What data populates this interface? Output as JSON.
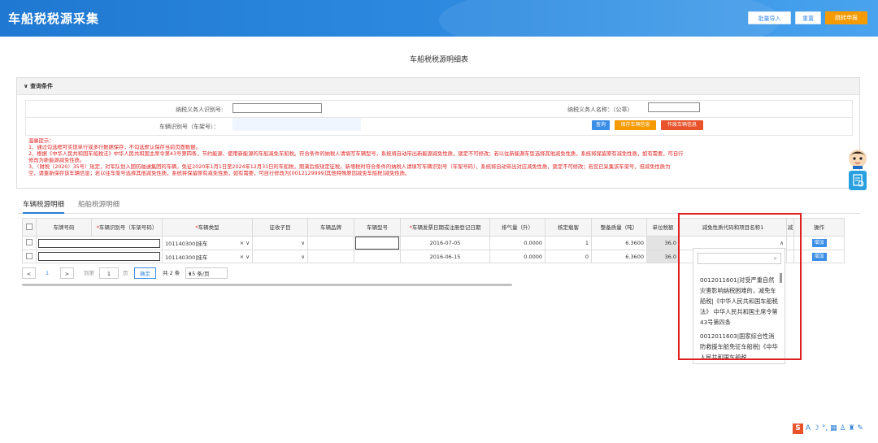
{
  "header": {
    "title": "车船税税源采集",
    "buttons": {
      "batch_import": "批量导入",
      "reset": "重置",
      "jump_declare": "跳转申报"
    }
  },
  "page_title": "车船税税源明细表",
  "query": {
    "section_title": "查询条件",
    "taxpayer_id_label": "纳税义务人识别号:",
    "taxpayer_id_value": "",
    "taxpayer_name_label": "纳税义务人名称：（公章）",
    "taxpayer_name_value": "",
    "vin_label": "车辆识别号（车架号）：",
    "vin_value": "",
    "buttons": {
      "query": "查询",
      "save_vehicle": "保存车辆信息",
      "void_vehicle": "作废车辆信息"
    }
  },
  "tips": {
    "title": "温馨提示：",
    "lines": [
      "1、通过勾选框可实现单行或多行数据保存，不勾选默认保存当前页面数据。",
      "2、根据《中华人民共和国车船税法》中华人民共和国主席令第43号第四条，节约能源、使用新能源的车船减免车船税。符合条件的纳税人请填写车辆型号，系统将自动带出新能源减免性质，锁定不可修改；若以往新能源车型选择其他减免性质，系统将保留原有减免性质，如有需要，可自行",
      "修改为新能源减免性质。",
      "3、（财税〔2020〕35号）规定，对军队划入国防融通集团的车辆，免征2020年1月1日至2024年12月31日的车船税，期满后按规定征税。新增税时符合条件的纳税人请填写车辆识别号（车架号码），系统将自动带出对应减免性质，锁定不可修改；若您已采集该车架号，但减免性质为",
      "空，请重新保存该车辆信息；若以往车架号选择其他减免性质，系统将保留原有减免性质，如有需要，可自行修改为[0012129999]其他特殊原因减免车船税]减免性质。"
    ]
  },
  "tabs": [
    {
      "label": "车辆税源明细",
      "active": true
    },
    {
      "label": "船舶税源明细",
      "active": false
    }
  ],
  "table": {
    "columns": [
      {
        "label": "车牌号码",
        "required": false
      },
      {
        "label": "车辆识别号（车架号码）",
        "required": true
      },
      {
        "label": "车辆类型",
        "required": true
      },
      {
        "label": "征收子目",
        "required": false
      },
      {
        "label": "车辆品牌",
        "required": false
      },
      {
        "label": "车辆型号",
        "required": false
      },
      {
        "label": "车辆发票日期或注册登记日期",
        "required": true
      },
      {
        "label": "排气量（升）",
        "required": false
      },
      {
        "label": "核定载客",
        "required": false
      },
      {
        "label": "整备质量（吨）",
        "required": false
      },
      {
        "label": "单位税额",
        "required": false
      },
      {
        "label": "减免性质代码和项目名称1",
        "required": false
      },
      {
        "label": "减",
        "required": false
      },
      {
        "label": "操作",
        "required": false
      }
    ],
    "rows": [
      {
        "plate": "",
        "vin": "",
        "vehicle_type": "101140300|挂车",
        "subitem": "",
        "brand": "",
        "model": "",
        "date": "2016-07-05",
        "displacement": "0.0000",
        "seats": "1",
        "weight": "6.3600",
        "unit_tax": "36.0",
        "relief": "",
        "op": "增加"
      },
      {
        "plate": "",
        "vin": "",
        "vehicle_type": "101140300|挂车",
        "subitem": "",
        "brand": "",
        "model": "",
        "date": "2016-06-15",
        "displacement": "0.0000",
        "seats": "0",
        "weight": "6.3600",
        "unit_tax": "36.0",
        "relief": "",
        "op": "增加"
      }
    ]
  },
  "pager": {
    "current": "1",
    "goto_prefix": "到第",
    "goto_value": "1",
    "goto_suffix": "页",
    "confirm": "确定",
    "total": "共 2 条",
    "page_size": "15 条/页"
  },
  "dropdown": {
    "search_placeholder": "",
    "options": [
      "0012011601|对受严重自然灾害影响纳税困难的，减免车船税|《中华人民共和国车船税法》 中华人民共和国主席令第43号第四条",
      "0012011603|国家综合性消防救援车船免征车船税|《中华人民共和国车船税"
    ]
  },
  "colors": {
    "header_blue": "#2e8be0",
    "button_blue": "#3a8ee6",
    "button_orange": "#f59a00",
    "button_red": "#e8532b",
    "warning_red": "#e02020"
  }
}
